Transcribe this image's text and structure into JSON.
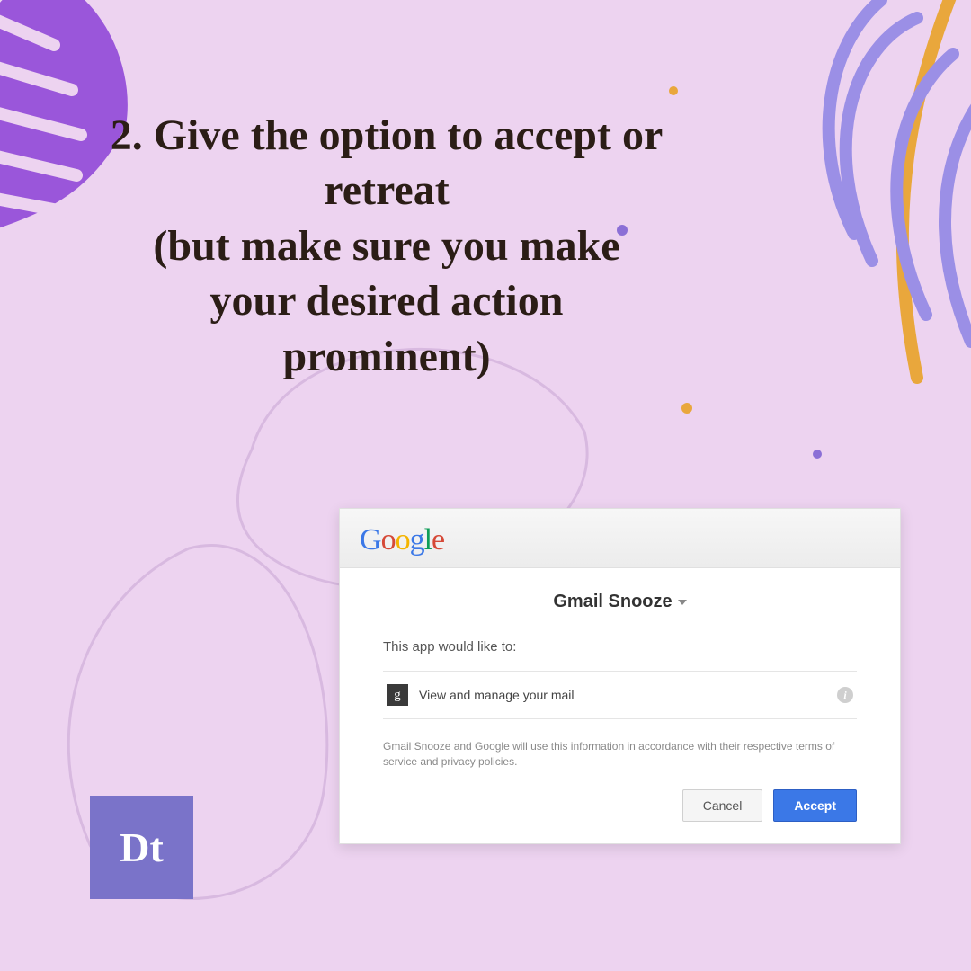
{
  "headline": "2. Give the option to accept or retreat\n(but make sure you make your desired action prominent)",
  "badge": "Dt",
  "google_letters": [
    "G",
    "o",
    "o",
    "g",
    "l",
    "e"
  ],
  "dialog": {
    "app_title": "Gmail Snooze",
    "prompt_text": "This app would like to:",
    "g_icon_label": "g",
    "permission_text": "View and manage your mail",
    "disclaimer": "Gmail Snooze and Google will use this information in accordance with their respective terms of service and privacy policies.",
    "cancel_label": "Cancel",
    "accept_label": "Accept"
  }
}
